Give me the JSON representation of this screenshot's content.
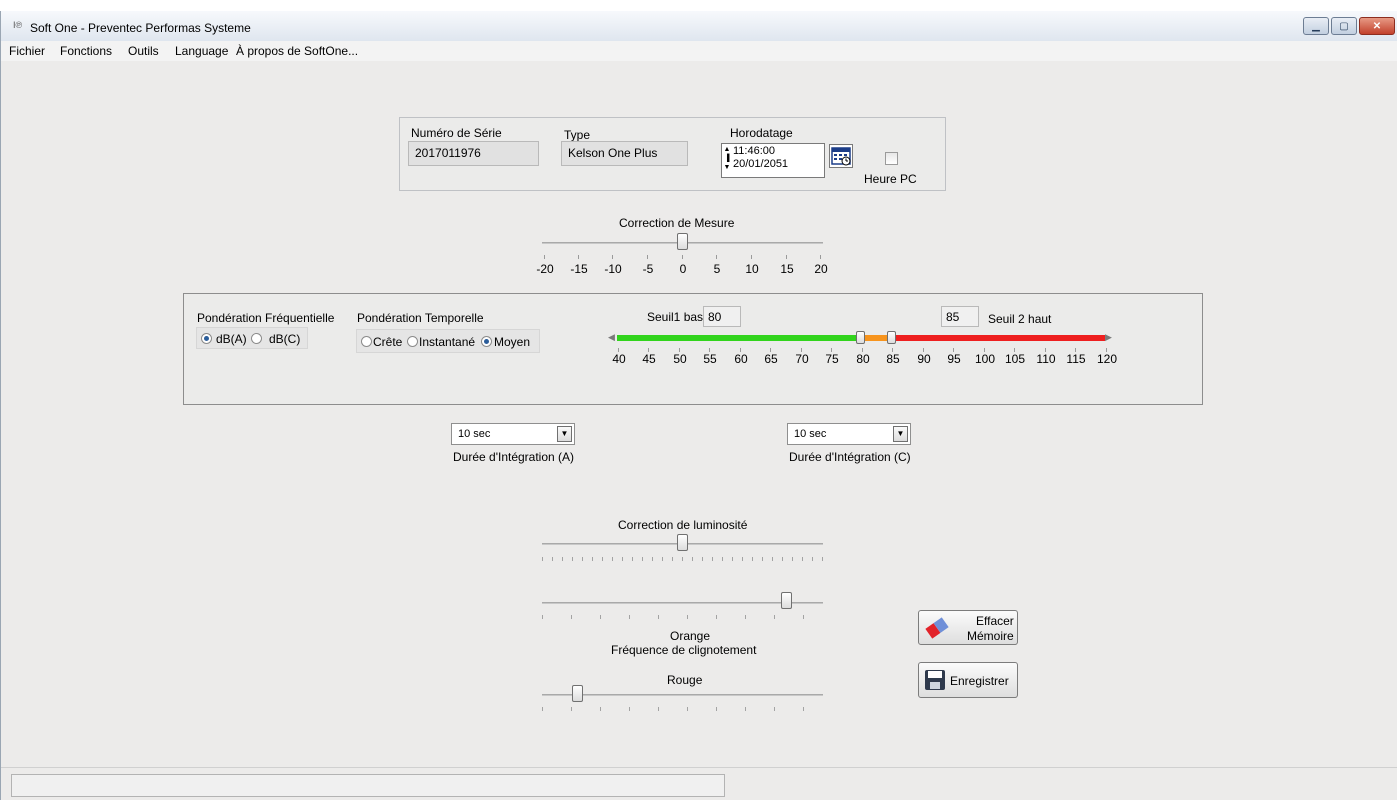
{
  "window": {
    "title": "Soft One - Preventec Performas Systeme"
  },
  "menu": [
    "Fichier",
    "Fonctions",
    "Outils",
    "Language",
    "À propos de SoftOne..."
  ],
  "device": {
    "serial_label": "Numéro de Série",
    "serial_value": "2017011976",
    "type_label": "Type",
    "type_value": "Kelson One Plus",
    "timestamp_label": "Horodatage",
    "time_value": "11:46:00",
    "date_value": "20/01/2051",
    "pc_time_label": "Heure PC"
  },
  "measure_correction": {
    "label": "Correction de Mesure",
    "value": 0,
    "range": [
      -20,
      20
    ],
    "ticks": [
      "-20",
      "-15",
      "-10",
      "-5",
      "0",
      "5",
      "10",
      "15",
      "20"
    ]
  },
  "weighting": {
    "freq_label": "Pondération Fréquentielle",
    "freq_options": [
      "dB(A)",
      "dB(C)"
    ],
    "freq_selected": "dB(A)",
    "time_label": "Pondération Temporelle",
    "time_options": [
      "Crête",
      "Instantané",
      "Moyen"
    ],
    "time_selected": "Moyen"
  },
  "thresholds": {
    "low_label": "Seuil1 bas",
    "low_value": "80",
    "high_label": "Seuil 2 haut",
    "high_value": "85",
    "range": [
      40,
      120
    ],
    "ticks": [
      "40",
      "45",
      "50",
      "55",
      "60",
      "65",
      "70",
      "75",
      "80",
      "85",
      "90",
      "95",
      "100",
      "105",
      "110",
      "115",
      "120"
    ],
    "colors": {
      "green": "#31d41c",
      "orange": "#f7941d",
      "red": "#ee1f1f"
    }
  },
  "integration": {
    "a_value": "10 sec",
    "a_label": "Durée d'Intégration (A)",
    "c_value": "10 sec",
    "c_label": "Durée d'Intégration (C)"
  },
  "brightness": {
    "label": "Correction de luminosité",
    "value": 0.5
  },
  "blink": {
    "orange_label": "Orange",
    "frequency_label": "Fréquence de clignotement",
    "orange_value": 0.88,
    "red_label": "Rouge",
    "red_value": 0.13
  },
  "buttons": {
    "erase_line1": "Effacer",
    "erase_line2": "Mémoire",
    "save": "Enregistrer"
  }
}
